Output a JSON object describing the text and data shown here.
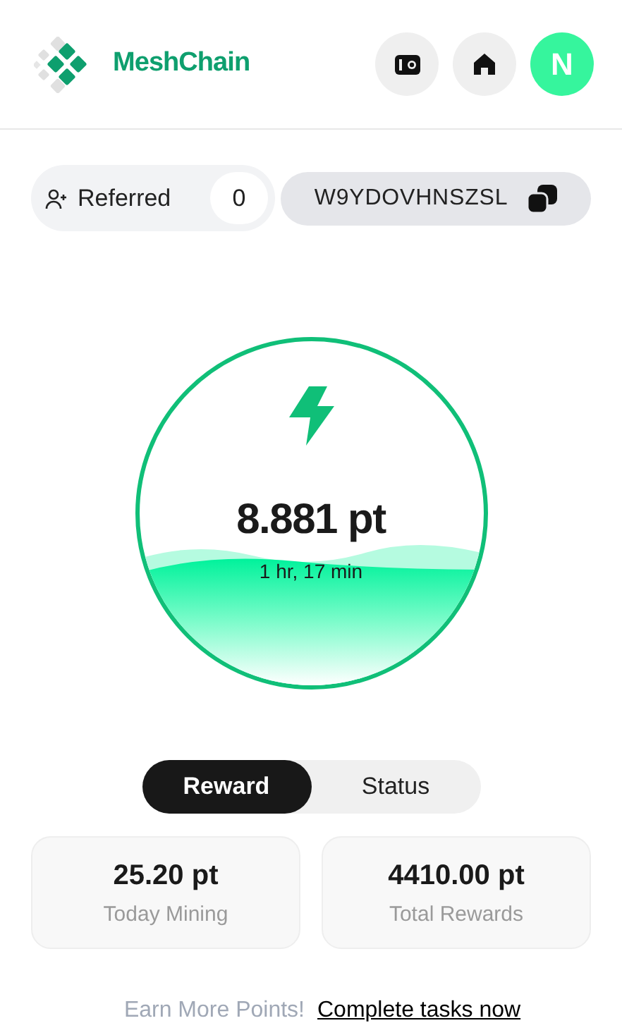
{
  "header": {
    "brand": "MeshChain",
    "avatar_initial": "N"
  },
  "referral": {
    "label": "Referred",
    "count": "0",
    "code": "W9YDOVHNSZSL"
  },
  "mining": {
    "points": "8.881 pt",
    "duration": "1 hr, 17 min"
  },
  "tabs": [
    {
      "label": "Reward",
      "selected": true
    },
    {
      "label": "Status",
      "selected": false
    }
  ],
  "stats": [
    {
      "value": "25.20 pt",
      "label": "Today Mining"
    },
    {
      "value": "4410.00 pt",
      "label": "Total Rewards"
    }
  ],
  "footer": {
    "text": "Earn More Points!",
    "link": "Complete tasks now"
  }
}
